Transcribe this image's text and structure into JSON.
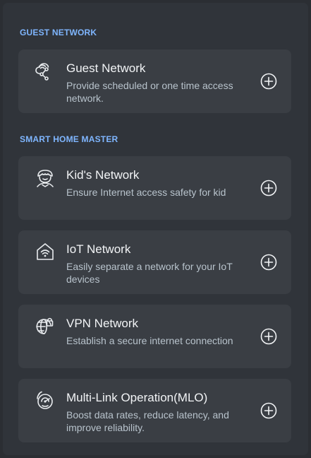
{
  "sections": {
    "guest_title": "GUEST NETWORK",
    "smart_home_title": "SMART HOME MASTER"
  },
  "cards": [
    {
      "icon": "guest-network-icon",
      "title": "Guest Network",
      "desc": "Provide scheduled or one time access network."
    },
    {
      "icon": "kids-network-icon",
      "title": "Kid's Network",
      "desc": "Ensure Internet access safety for kid"
    },
    {
      "icon": "iot-network-icon",
      "title": "IoT Network",
      "desc": "Easily separate a network for your IoT devices"
    },
    {
      "icon": "vpn-network-icon",
      "title": "VPN Network",
      "desc": "Establish a secure internet connection"
    },
    {
      "icon": "mlo-icon",
      "title": "Multi-Link Operation(MLO)",
      "desc": "Boost data rates, reduce latency, and improve reliability."
    }
  ],
  "colors": {
    "background": "#2b2e33",
    "panel": "#30343a",
    "card": "#3a3e44",
    "accent": "#7fb6ff",
    "title_text": "#f2f4f6",
    "desc_text": "#b8c3cc"
  }
}
